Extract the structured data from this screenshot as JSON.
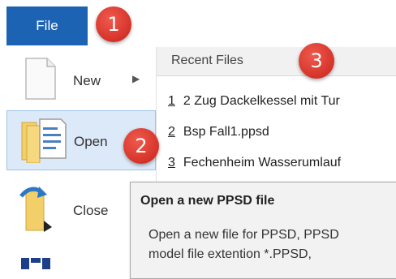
{
  "file_tab": {
    "label": "File"
  },
  "menu": {
    "items": [
      {
        "label": "New",
        "icon": "blank-document-icon"
      },
      {
        "label": "Open",
        "icon": "open-document-icon"
      },
      {
        "label": "Close",
        "icon": "close-document-icon"
      }
    ]
  },
  "recent": {
    "header": "Recent Files",
    "files": [
      {
        "num": "1",
        "name": "2 Zug Dackelkessel mit Tur"
      },
      {
        "num": "2",
        "name": "Bsp Fall1.ppsd"
      },
      {
        "num": "3",
        "name": "Fechenheim Wasserumlauf"
      }
    ]
  },
  "tooltip": {
    "title": "Open a new PPSD file",
    "line1": "Open a new file for PPSD, PPSD",
    "line2": "model file extention *.PPSD,"
  },
  "callouts": [
    "1",
    "2",
    "3"
  ],
  "colors": {
    "file_tab": "#1d63b4",
    "selected_bg": "#dce9f8",
    "callout": "#d9342b"
  }
}
